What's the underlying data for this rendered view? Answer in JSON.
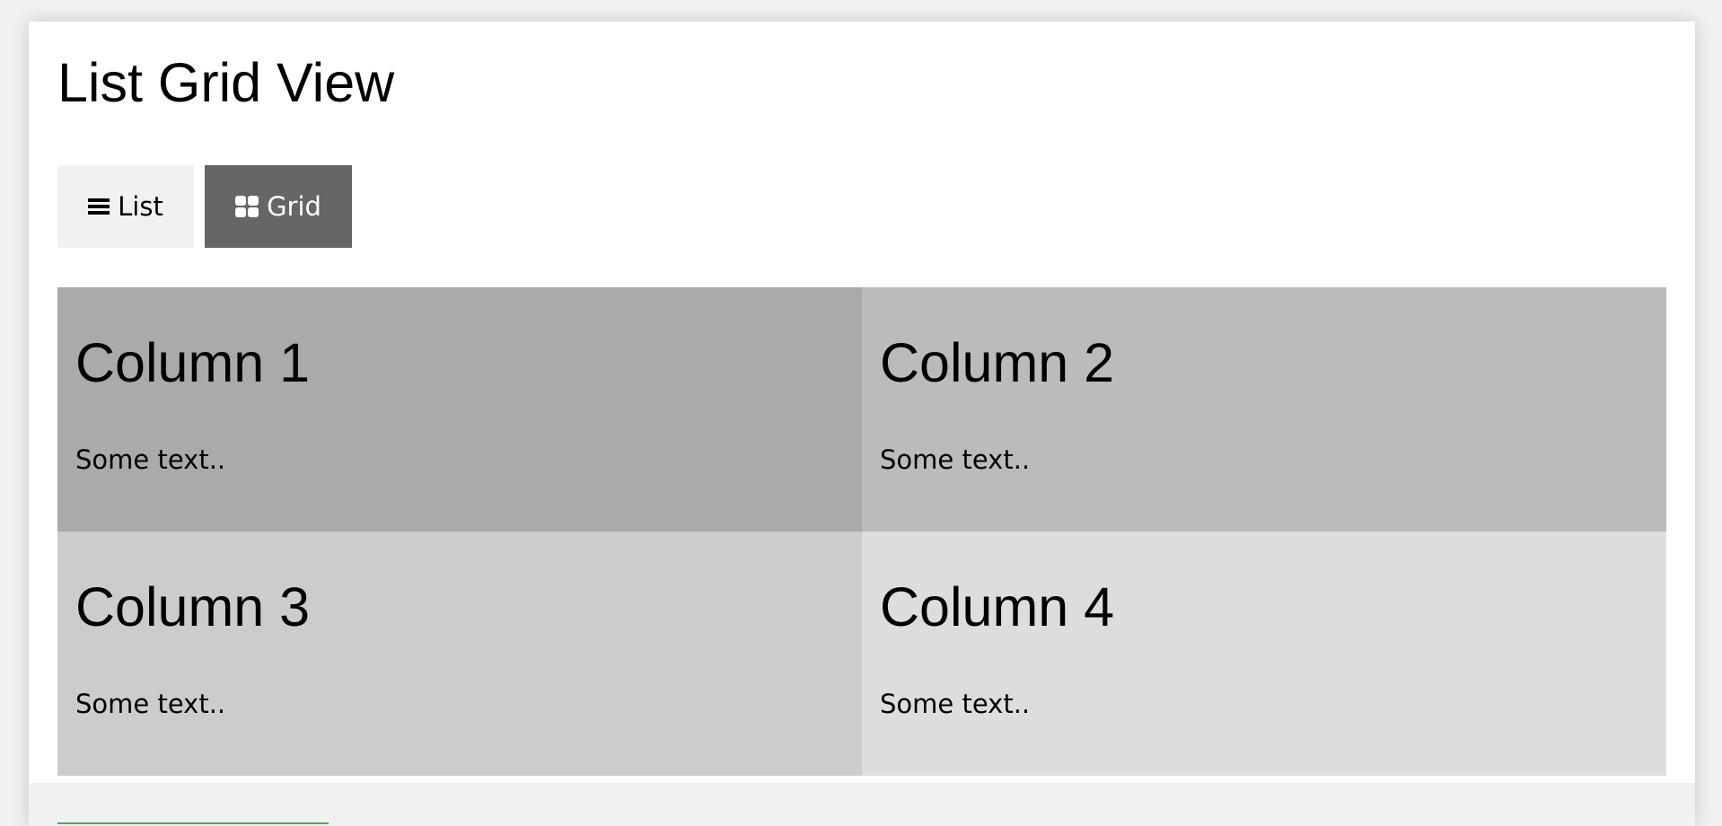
{
  "page": {
    "title": "List Grid View"
  },
  "toolbar": {
    "list_label": "List",
    "grid_label": "Grid"
  },
  "columns": [
    {
      "title": "Column 1",
      "text": "Some text..",
      "color": "#aaaaaa"
    },
    {
      "title": "Column 2",
      "text": "Some text..",
      "color": "#bbbbbb"
    },
    {
      "title": "Column 3",
      "text": "Some text..",
      "color": "#cccccc"
    },
    {
      "title": "Column 4",
      "text": "Some text..",
      "color": "#dddddd"
    }
  ],
  "icons": {
    "list": "bars-icon",
    "grid": "th-large-icon"
  },
  "colors": {
    "active_button": "#666666",
    "inactive_button": "#f1f1f1",
    "footer_accent": "#4caf50"
  }
}
